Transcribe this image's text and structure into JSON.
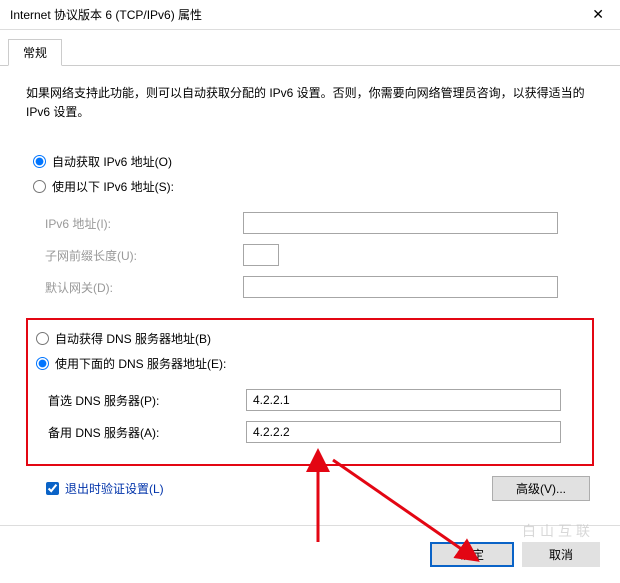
{
  "window": {
    "title": "Internet 协议版本 6 (TCP/IPv6) 属性"
  },
  "tabs": {
    "general": "常规"
  },
  "description": "如果网络支持此功能，则可以自动获取分配的 IPv6 设置。否则，你需要向网络管理员咨询，以获得适当的 IPv6 设置。",
  "addr": {
    "radio_auto": "自动获取 IPv6 地址(O)",
    "radio_manual": "使用以下 IPv6 地址(S):",
    "ipv6_label": "IPv6 地址(I):",
    "prefix_label": "子网前缀长度(U):",
    "gateway_label": "默认网关(D):",
    "ipv6_value": "",
    "prefix_value": "",
    "gateway_value": ""
  },
  "dns": {
    "radio_auto": "自动获得 DNS 服务器地址(B)",
    "radio_manual": "使用下面的 DNS 服务器地址(E):",
    "preferred_label": "首选 DNS 服务器(P):",
    "alternate_label": "备用 DNS 服务器(A):",
    "preferred_value": "4.2.2.1",
    "alternate_value": "4.2.2.2"
  },
  "validate_label": "退出时验证设置(L)",
  "buttons": {
    "advanced": "高级(V)...",
    "ok": "确定",
    "cancel": "取消"
  },
  "watermark": "白山互联"
}
